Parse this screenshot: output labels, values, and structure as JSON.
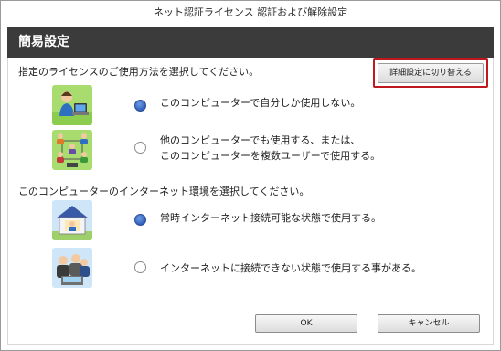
{
  "window": {
    "title": "ネット認証ライセンス 認証および解除設定"
  },
  "header": {
    "title": "簡易設定"
  },
  "license_section": {
    "prompt": "指定のライセンスのご使用方法を選択してください。",
    "detail_button": "詳細設定に切り替える",
    "options": [
      {
        "lines": [
          "このコンピューターで自分しか使用しない。"
        ],
        "selected": true,
        "icon": "single-user-pc-icon"
      },
      {
        "lines": [
          "他のコンピューターでも使用する、または、",
          "このコンピューターを複数ユーザーで使用する。"
        ],
        "selected": false,
        "icon": "multi-user-network-icon"
      }
    ]
  },
  "internet_section": {
    "prompt": "このコンピューターのインターネット環境を選択してください。",
    "options": [
      {
        "lines": [
          "常時インターネット接続可能な状態で使用する。"
        ],
        "selected": true,
        "icon": "home-connected-icon"
      },
      {
        "lines": [
          "インターネットに接続できない状態で使用する事がある。"
        ],
        "selected": false,
        "icon": "offline-group-icon"
      }
    ]
  },
  "footer": {
    "ok_label": "OK",
    "cancel_label": "キャンセル"
  },
  "colors": {
    "header_bg": "#3b3b3b",
    "highlight_border": "#c0181f",
    "radio_selected": "#2f5fb8",
    "icon_bg": "#a8dc6e"
  }
}
